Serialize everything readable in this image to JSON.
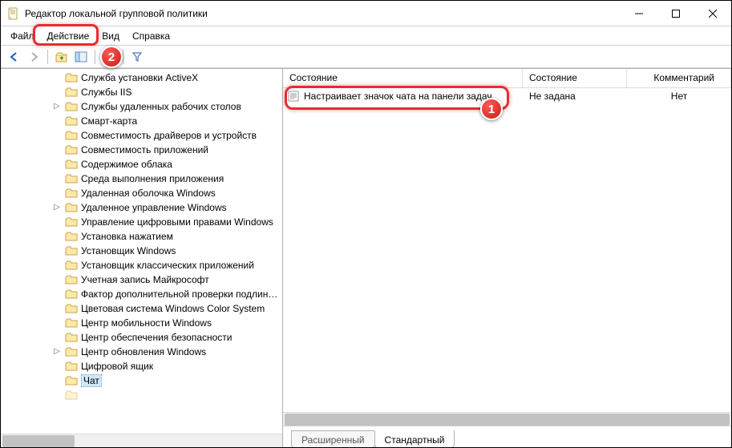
{
  "window": {
    "title": "Редактор локальной групповой политики"
  },
  "menu": {
    "file": "Файл",
    "action": "Действие",
    "view": "Вид",
    "help": "Справка"
  },
  "columns": {
    "state": "Состояние",
    "status": "Состояние",
    "comment": "Комментарий"
  },
  "settings": [
    {
      "name": "Настраивает значок чата на панели задач",
      "status": "Не задана",
      "comment": "Нет"
    }
  ],
  "tabs": {
    "extended": "Расширенный",
    "standard": "Стандартный"
  },
  "tree": {
    "items": [
      {
        "label": "Служба установки ActiveX",
        "expander": ""
      },
      {
        "label": "Службы IIS",
        "expander": ""
      },
      {
        "label": "Службы удаленных рабочих столов",
        "expander": ">"
      },
      {
        "label": "Смарт-карта",
        "expander": ""
      },
      {
        "label": "Совместимость драйверов и устройств",
        "expander": ""
      },
      {
        "label": "Совместимость приложений",
        "expander": ""
      },
      {
        "label": "Содержимое облака",
        "expander": ""
      },
      {
        "label": "Среда выполнения приложения",
        "expander": ""
      },
      {
        "label": "Удаленная оболочка Windows",
        "expander": ""
      },
      {
        "label": "Удаленное управление Windows",
        "expander": ">"
      },
      {
        "label": "Управление цифровыми правами Windows",
        "expander": ""
      },
      {
        "label": "Установка нажатием",
        "expander": ""
      },
      {
        "label": "Установщик Windows",
        "expander": ""
      },
      {
        "label": "Установщик классических приложений",
        "expander": ""
      },
      {
        "label": "Учетная запись Майкрософт",
        "expander": ""
      },
      {
        "label": "Фактор дополнительной проверки подлинности",
        "expander": ""
      },
      {
        "label": "Цветовая система Windows Color System",
        "expander": ""
      },
      {
        "label": "Центр мобильности Windows",
        "expander": ""
      },
      {
        "label": "Центр обеспечения безопасности",
        "expander": ""
      },
      {
        "label": "Центр обновления Windows",
        "expander": ">"
      },
      {
        "label": "Цифровой ящик",
        "expander": ""
      },
      {
        "label": "Чат",
        "expander": "",
        "selected": true
      }
    ]
  }
}
